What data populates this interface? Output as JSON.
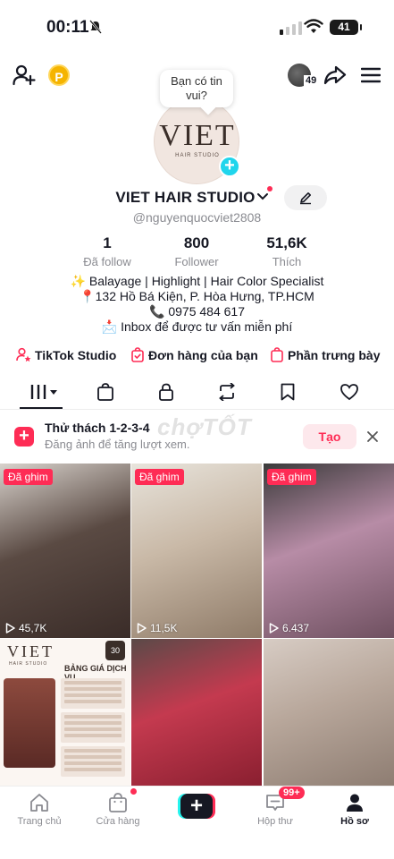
{
  "status_bar": {
    "time": "00:11",
    "battery": "41"
  },
  "top_bar": {
    "coin_label": "P",
    "friends_count": "49"
  },
  "tooltip": {
    "text": "Bạn có tin vui?"
  },
  "avatar": {
    "logo_text": "VIET",
    "logo_sub": "HAIR STUDIO"
  },
  "profile": {
    "name": "VIET HAIR STUDIO",
    "username": "@nguyenquocviet2808"
  },
  "stats": [
    {
      "value": "1",
      "label": "Đã follow"
    },
    {
      "value": "800",
      "label": "Follower"
    },
    {
      "value": "51,6K",
      "label": "Thích"
    }
  ],
  "bio": [
    "✨ Balayage | Highlight | Hair Color Specialist",
    "📍132 Hồ Bá Kiện, P. Hòa Hưng, TP.HCM",
    "📞 0975 484 617",
    "📩 Inbox để được tư vấn miễn phí"
  ],
  "links": [
    {
      "label": "TikTok Studio",
      "icon": "person-star-icon"
    },
    {
      "label": "Đơn hàng của bạn",
      "icon": "order-bag-icon"
    },
    {
      "label": "Phần trưng bày",
      "icon": "showcase-bag-icon"
    }
  ],
  "challenge": {
    "title": "Thử thách 1-2-3-4",
    "subtitle": "Đăng ảnh để tăng lượt xem.",
    "button": "Tạo"
  },
  "watermark": "chợTỐT",
  "videos": [
    {
      "pinned_label": "Đã ghim",
      "views": "45,7K",
      "colors": [
        "#5a4a43",
        "#3a2c28",
        "#d8d2cc"
      ]
    },
    {
      "pinned_label": "Đã ghim",
      "views": "11,5K",
      "colors": [
        "#c9b9a7",
        "#8f7b68",
        "#e8e4dc"
      ]
    },
    {
      "pinned_label": "Đã ghim",
      "views": "6.437",
      "colors": [
        "#b78ca6",
        "#6f5060",
        "#3a3a3a"
      ]
    },
    {
      "pinned_label": "",
      "views": "",
      "colors": [
        "#fbf6f2"
      ]
    },
    {
      "pinned_label": "",
      "views": "",
      "colors": [
        "#c43a4f",
        "#8a1f30",
        "#5a4a48"
      ]
    },
    {
      "pinned_label": "",
      "views": "",
      "colors": [
        "#b8a79b",
        "#8e7d72",
        "#d7ccc4"
      ]
    }
  ],
  "price_card": {
    "title": "BẢNG GIÁ DỊCH VỤ",
    "badge": "30"
  },
  "bottom_nav": [
    {
      "label": "Trang chủ",
      "icon": "home-icon"
    },
    {
      "label": "Cửa hàng",
      "icon": "shop-icon"
    },
    {
      "label": "",
      "icon": "create-plus-icon"
    },
    {
      "label": "Hộp thư",
      "icon": "inbox-icon",
      "badge": "99+"
    },
    {
      "label": "Hồ sơ",
      "icon": "profile-icon"
    }
  ],
  "colors": {
    "accent": "#fe2c55",
    "cyan": "#25f4ee",
    "text": "#161823",
    "muted": "#8a8b91"
  }
}
